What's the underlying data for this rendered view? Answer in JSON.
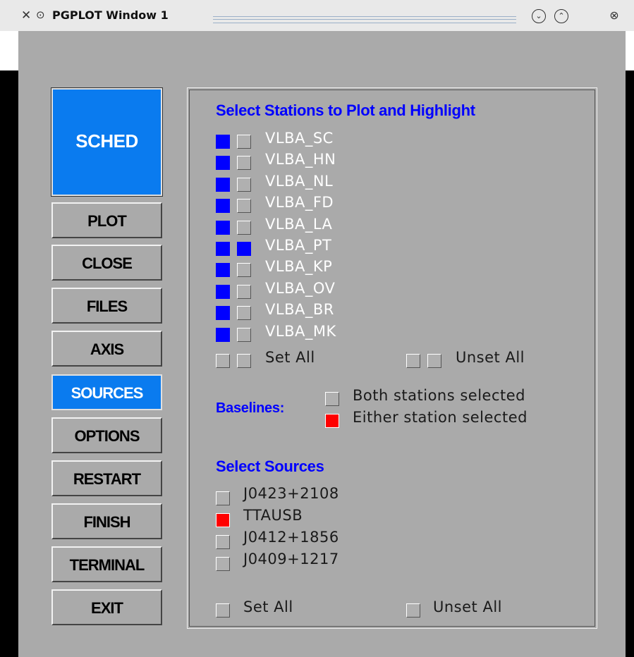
{
  "window": {
    "title": "PGPLOT Window 1"
  },
  "sidebar": {
    "logo": "SCHED",
    "buttons": [
      "PLOT",
      "CLOSE",
      "FILES",
      "AXIS",
      "SOURCES",
      "OPTIONS",
      "RESTART",
      "FINISH",
      "TERMINAL",
      "EXIT"
    ],
    "active": "SOURCES"
  },
  "stations": {
    "heading": "Select Stations to Plot and Highlight",
    "items": [
      {
        "name": "VLBA_SC",
        "plot": true,
        "highlight": false
      },
      {
        "name": "VLBA_HN",
        "plot": true,
        "highlight": false
      },
      {
        "name": "VLBA_NL",
        "plot": true,
        "highlight": false
      },
      {
        "name": "VLBA_FD",
        "plot": true,
        "highlight": false
      },
      {
        "name": "VLBA_LA",
        "plot": true,
        "highlight": false
      },
      {
        "name": "VLBA_PT",
        "plot": true,
        "highlight": true
      },
      {
        "name": "VLBA_KP",
        "plot": true,
        "highlight": false
      },
      {
        "name": "VLBA_OV",
        "plot": true,
        "highlight": false
      },
      {
        "name": "VLBA_BR",
        "plot": true,
        "highlight": false
      },
      {
        "name": "VLBA_MK",
        "plot": true,
        "highlight": false
      }
    ],
    "set_all": "Set All",
    "unset_all": "Unset All"
  },
  "baselines": {
    "label": "Baselines:",
    "options": [
      {
        "text": "Both stations selected",
        "selected": false
      },
      {
        "text": "Either station selected",
        "selected": true
      }
    ]
  },
  "sources": {
    "heading": "Select Sources",
    "items": [
      {
        "name": "J0423+2108",
        "selected": false
      },
      {
        "name": "TTAUSB",
        "selected": true
      },
      {
        "name": "J0412+1856",
        "selected": false
      },
      {
        "name": "J0409+1217",
        "selected": false
      }
    ],
    "set_all": "Set All",
    "unset_all": "Unset All"
  },
  "colors": {
    "accent": "#0a7bef",
    "selected_blue": "#0000ff",
    "selected_red": "#ff0000",
    "panel_bg": "#aaaaaa"
  }
}
